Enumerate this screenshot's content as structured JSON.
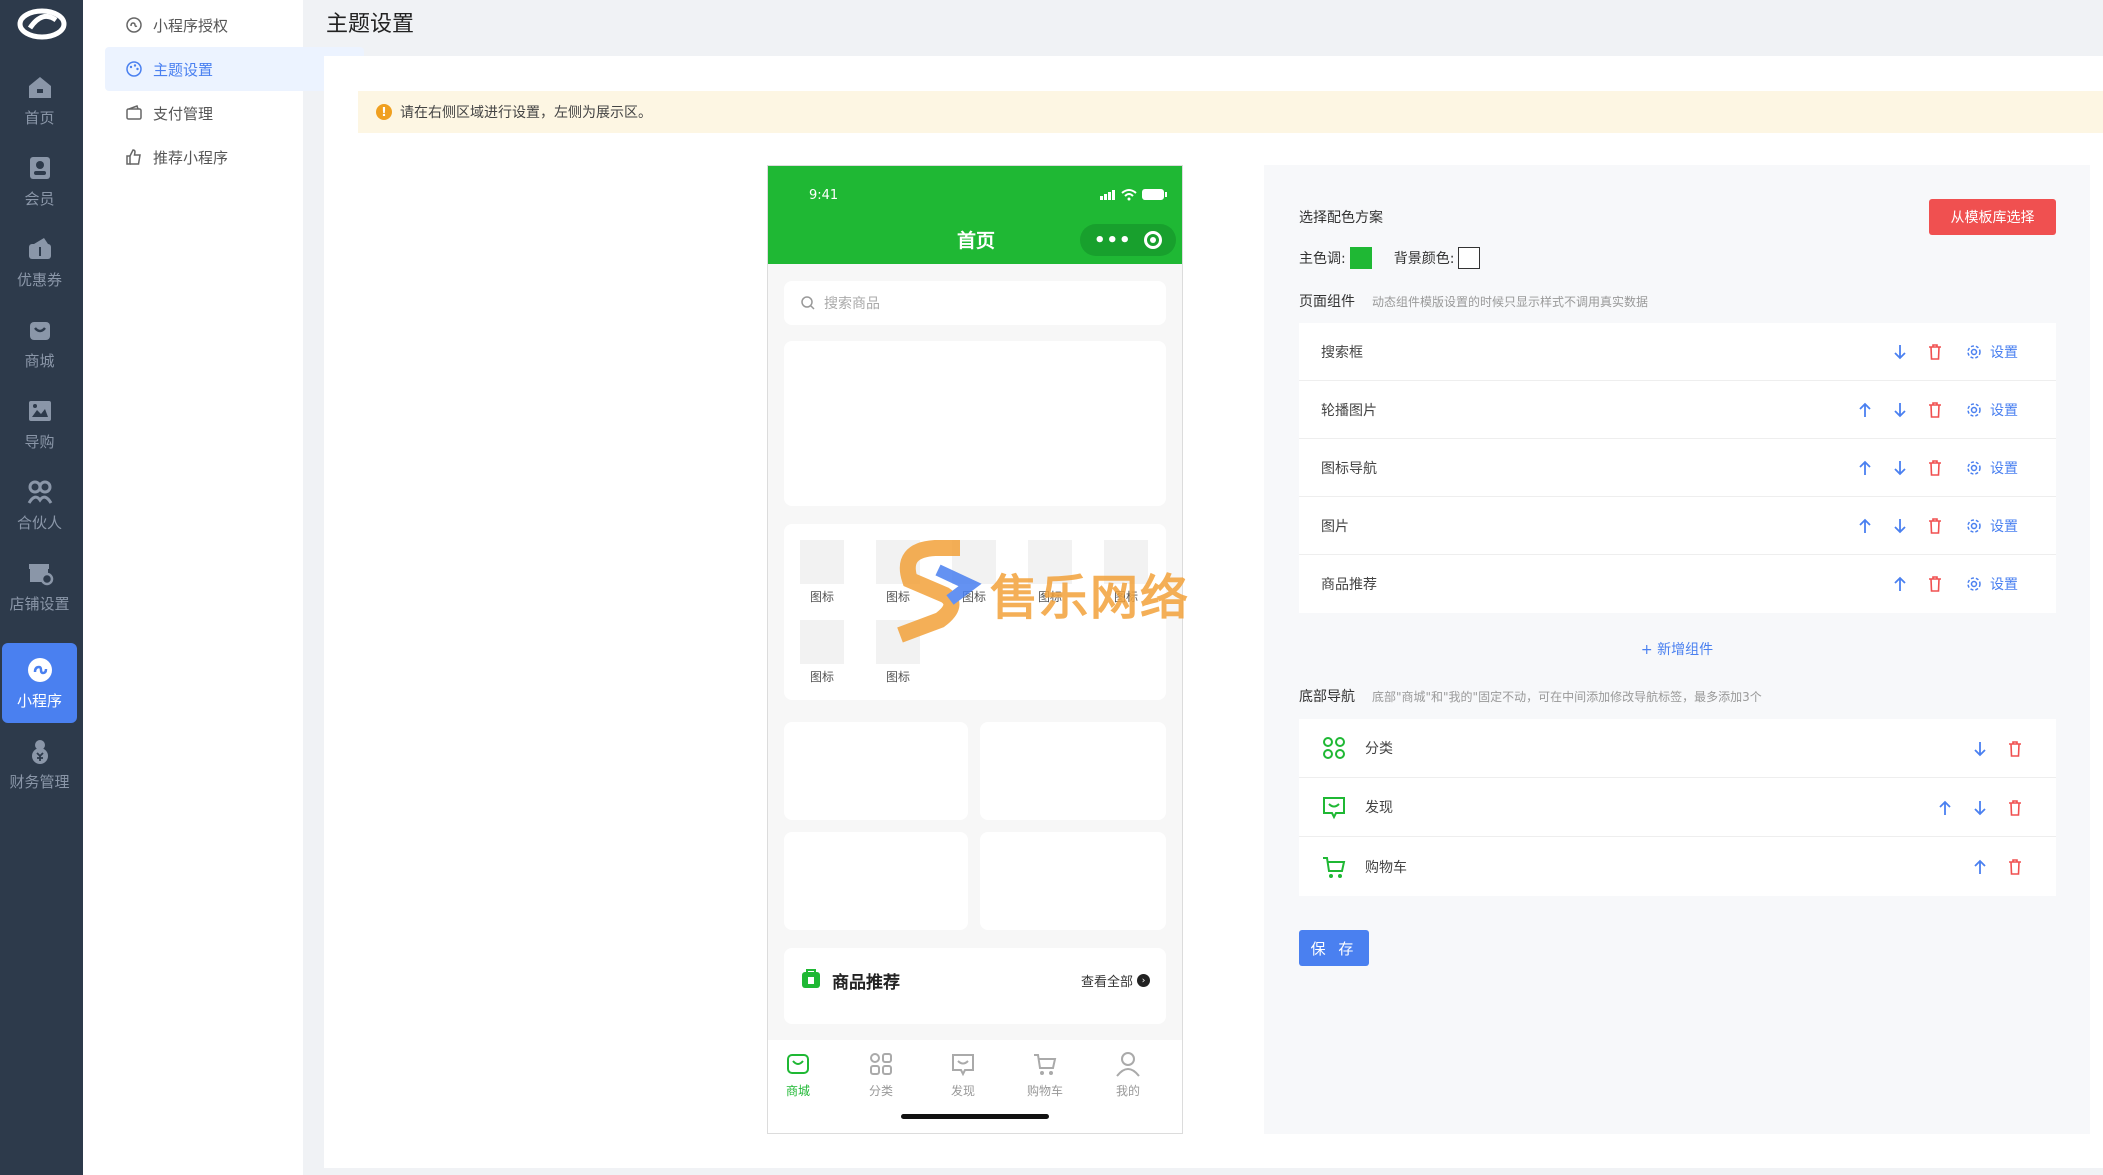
{
  "colors": {
    "primary": "#1fb834",
    "accent": "#4a80f0",
    "danger": "#f05050",
    "rail": "#2d3a4b"
  },
  "rail": {
    "items": [
      {
        "label": "首页",
        "icon": "home-icon"
      },
      {
        "label": "会员",
        "icon": "member-icon"
      },
      {
        "label": "优惠券",
        "icon": "coupon-icon"
      },
      {
        "label": "商城",
        "icon": "mall-icon"
      },
      {
        "label": "导购",
        "icon": "guide-icon"
      },
      {
        "label": "合伙人",
        "icon": "partner-icon"
      },
      {
        "label": "店铺设置",
        "icon": "store-settings-icon"
      },
      {
        "label": "小程序",
        "icon": "miniprogram-icon"
      },
      {
        "label": "财务管理",
        "icon": "finance-icon"
      }
    ]
  },
  "submenu": {
    "items": [
      {
        "label": "小程序授权",
        "icon": "authorize-icon"
      },
      {
        "label": "主题设置",
        "icon": "palette-icon"
      },
      {
        "label": "支付管理",
        "icon": "wallet-icon"
      },
      {
        "label": "推荐小程序",
        "icon": "thumbs-up-icon"
      }
    ]
  },
  "page": {
    "title": "主题设置",
    "notice": "请在右侧区域进行设置，左侧为展示区。"
  },
  "phone": {
    "time": "9:41",
    "title": "首页",
    "search_placeholder": "搜索商品",
    "icon_label": "图标",
    "rec_title": "商品推荐",
    "rec_more": "查看全部",
    "tabs": [
      "商城",
      "分类",
      "发现",
      "购物车",
      "我的"
    ]
  },
  "watermark": "售乐网络",
  "panel": {
    "scheme_label": "选择配色方案",
    "template_button": "从模板库选择",
    "main_color_label": "主色调:",
    "bg_color_label": "背景颜色:",
    "components_label": "页面组件",
    "components_hint": "动态组件模版设置的时候只显示样式不调用真实数据",
    "set_label": "设置",
    "components": [
      "搜索框",
      "轮播图片",
      "图标导航",
      "图片",
      "商品推荐"
    ],
    "add_component": "+ 新增组件",
    "nav_label": "底部导航",
    "nav_hint": "底部\"商城\"和\"我的\"固定不动，可在中间添加修改导航标签，最多添加3个",
    "nav_items": [
      "分类",
      "发现",
      "购物车"
    ],
    "save_button": "保 存"
  }
}
